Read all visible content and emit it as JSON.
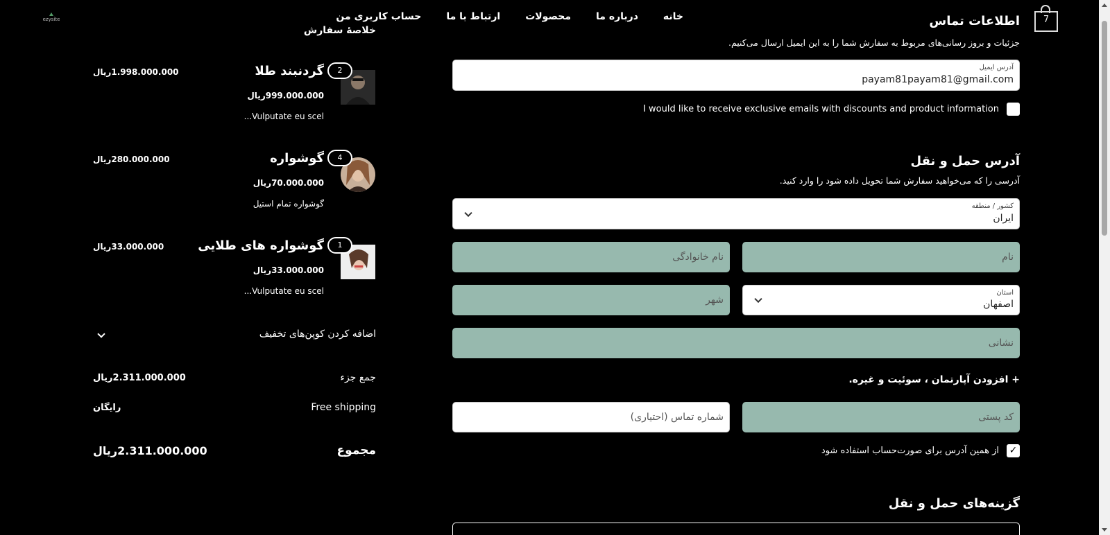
{
  "header": {
    "logo_text": "ezysite",
    "nav": [
      "خانه",
      "درباره ما",
      "محصولات",
      "ارتباط با ما",
      "حساب کاربری من"
    ],
    "cart_count": "7"
  },
  "contact": {
    "title": "اطلاعات تماس",
    "subtitle": "جزئیات و بروز رسانی‌های مربوط به سفارش شما را به این ایمیل ارسال می‌کنیم.",
    "email_label": "آدرس ایمیل",
    "email_value": "payam81payam81@gmail.com",
    "newsletter_label": "I would like to receive exclusive emails with discounts and product information"
  },
  "shipping": {
    "title": "آدرس حمل و نقل",
    "subtitle": "آدرسی را که می‌خواهید سفارش شما تحویل داده شود را وارد کنید.",
    "country_label": "کشور / منطقه",
    "country_value": "ایران",
    "first_name": "نام",
    "last_name": "نام خانوادگی",
    "province_label": "استان",
    "province_value": "اصفهان",
    "city": "شهر",
    "address": "نشانی",
    "add_apartment": "+ افزودن آپارتمان ، سوئیت و غیره.",
    "postal_code": "کد پستی",
    "phone": "شماره تماس (احتیاری)",
    "same_billing": "از همین آدرس برای صورت‌حساب استفاده شود",
    "same_billing_check": "✓"
  },
  "shipping_options": {
    "title": "گزینه‌های حمل و نقل"
  },
  "summary": {
    "title": "خلاصهٔ سفارش",
    "items": [
      {
        "qty": "2",
        "name": "گردنبند طلا",
        "unit_price": "999.000.000ریال",
        "desc": "Vulputate eu scel...",
        "total": "1.998.000.000ریال"
      },
      {
        "qty": "4",
        "name": "گوشواره",
        "unit_price": "70.000.000ریال",
        "desc": "گوشواره تمام استیل",
        "total": "280.000.000ریال"
      },
      {
        "qty": "1",
        "name": "گوشواره های طلایی",
        "unit_price": "33.000.000ریال",
        "desc": "Vulputate eu scel...",
        "total": "33.000.000ریال"
      }
    ],
    "coupon": "اضافه کردن کوپن‌های تخفیف",
    "subtotal_label": "جمع جزء",
    "subtotal_value": "2.311.000.000ریال",
    "shipping_label": "Free shipping",
    "shipping_value": "رایگان",
    "total_label": "مجموع",
    "total_value": "2.311.000.000ریال"
  },
  "colors": {
    "background": "#000000",
    "field_filled": "#97b9ae",
    "field_empty": "#ffffff"
  }
}
